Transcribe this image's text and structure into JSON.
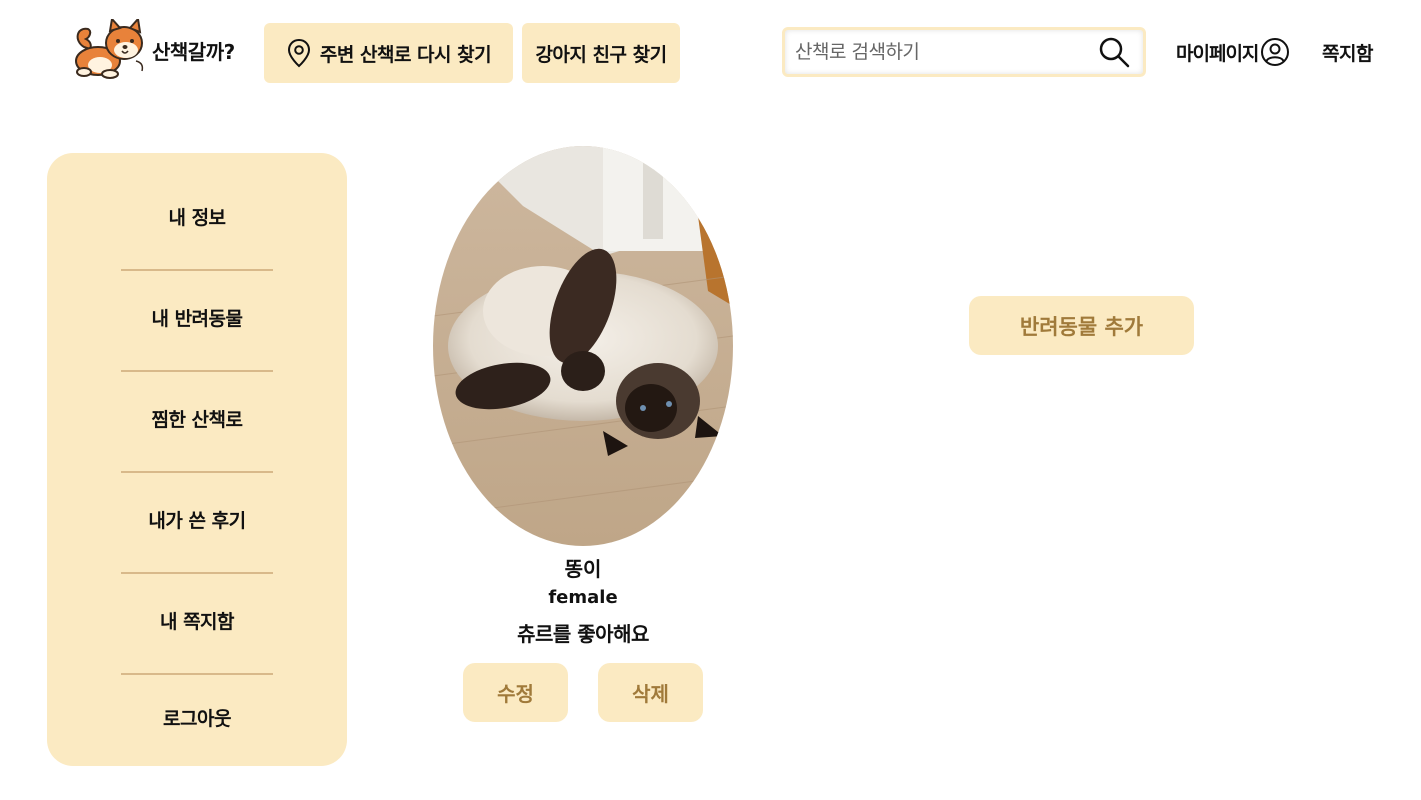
{
  "header": {
    "logo_text": "산책갈까?",
    "nav_nearby_label": "주변 산책로 다시 찾기",
    "nav_friends_label": "강아지 친구 찾기",
    "search_placeholder": "산책로 검색하기",
    "mypage_label": "마이페이지",
    "messages_label": "쪽지함",
    "icons": {
      "logo": "shiba-dog-logo",
      "nearby": "location-pin-icon",
      "search": "search-icon",
      "user": "user-circle-icon"
    }
  },
  "sidebar": {
    "items": [
      {
        "label": "내 정보"
      },
      {
        "label": "내 반려동물"
      },
      {
        "label": "찜한 산책로"
      },
      {
        "label": "내가 쓴 후기"
      },
      {
        "label": "내 쪽지함"
      },
      {
        "label": "로그아웃"
      }
    ]
  },
  "pet": {
    "name": "똥이",
    "gender": "female",
    "description": "츄르를 좋아해요",
    "edit_label": "수정",
    "delete_label": "삭제"
  },
  "actions": {
    "add_pet_label": "반려동물 추가"
  },
  "colors": {
    "accent_bg": "#fbeac2",
    "accent_text": "#a07a3a",
    "divider": "#d8b98a"
  }
}
